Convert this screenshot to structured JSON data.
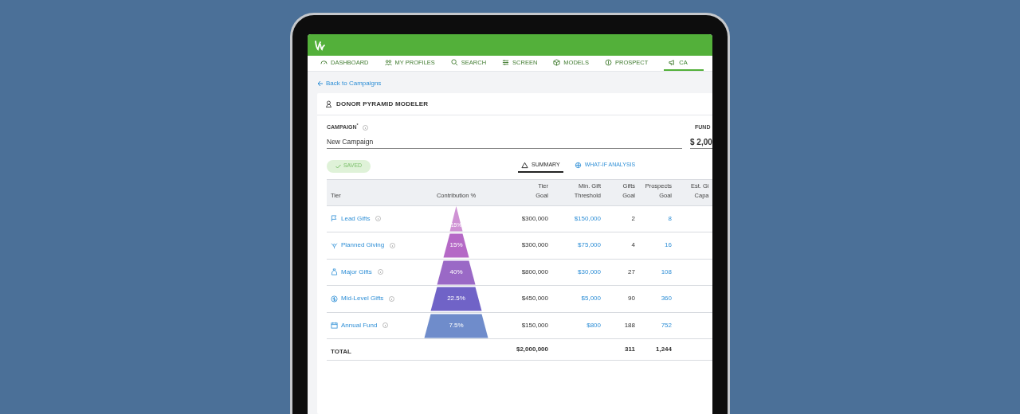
{
  "nav": [
    {
      "label": "DASHBOARD",
      "selected": false,
      "kind": "dashboard"
    },
    {
      "label": "MY PROFILES",
      "selected": false,
      "kind": "profiles"
    },
    {
      "label": "SEARCH",
      "selected": false,
      "kind": "search"
    },
    {
      "label": "SCREEN",
      "selected": false,
      "kind": "screen"
    },
    {
      "label": "MODELS",
      "selected": false,
      "kind": "models"
    },
    {
      "label": "PROSPECT",
      "selected": false,
      "kind": "prospect"
    },
    {
      "label": "CA",
      "selected": true,
      "kind": "campaigns"
    }
  ],
  "back_link": "Back to Campaigns",
  "card_title": "DONOR PYRAMID MODELER",
  "campaign_field": {
    "label": "CAMPAIGN",
    "required_mark": "*",
    "value": "New Campaign"
  },
  "fund_field": {
    "label": "FUND",
    "value": "$ 2,00"
  },
  "status_badge": "SAVED",
  "view_tabs": [
    {
      "label": "SUMMARY",
      "selected": true,
      "kind": "summary"
    },
    {
      "label": "WHAT-IF ANALYSIS",
      "selected": false,
      "kind": "whatif"
    }
  ],
  "table": {
    "columns": [
      "Tier",
      "Contribution %",
      "Tier\nGoal",
      "Min. Gift\nThreshold",
      "Gifts\nGoal",
      "Prospects\nGoal",
      "Est. Gi\nCapa"
    ],
    "rows": [
      {
        "tier": "Lead Gifts",
        "kind": "lead",
        "contribution": "15%",
        "color": "#cf92d4",
        "tier_goal": "$300,000",
        "min_gift": "$150,000",
        "gifts_goal": "2",
        "prospects_goal": "8"
      },
      {
        "tier": "Planned Giving",
        "kind": "planned",
        "contribution": "15%",
        "color": "#b569c6",
        "tier_goal": "$300,000",
        "min_gift": "$75,000",
        "gifts_goal": "4",
        "prospects_goal": "16"
      },
      {
        "tier": "Major Gifts",
        "kind": "major",
        "contribution": "40%",
        "color": "#9a69c6",
        "tier_goal": "$800,000",
        "min_gift": "$30,000",
        "gifts_goal": "27",
        "prospects_goal": "108"
      },
      {
        "tier": "Mid-Level Gifts",
        "kind": "midlevel",
        "contribution": "22.5%",
        "color": "#7063c7",
        "tier_goal": "$450,000",
        "min_gift": "$5,000",
        "gifts_goal": "90",
        "prospects_goal": "360"
      },
      {
        "tier": "Annual Fund",
        "kind": "annual",
        "contribution": "7.5%",
        "color": "#6f8ccb",
        "tier_goal": "$150,000",
        "min_gift": "$800",
        "gifts_goal": "188",
        "prospects_goal": "752"
      }
    ],
    "total": {
      "label": "TOTAL",
      "tier_goal": "$2,000,000",
      "gifts_goal": "311",
      "prospects_goal": "1,244"
    }
  }
}
